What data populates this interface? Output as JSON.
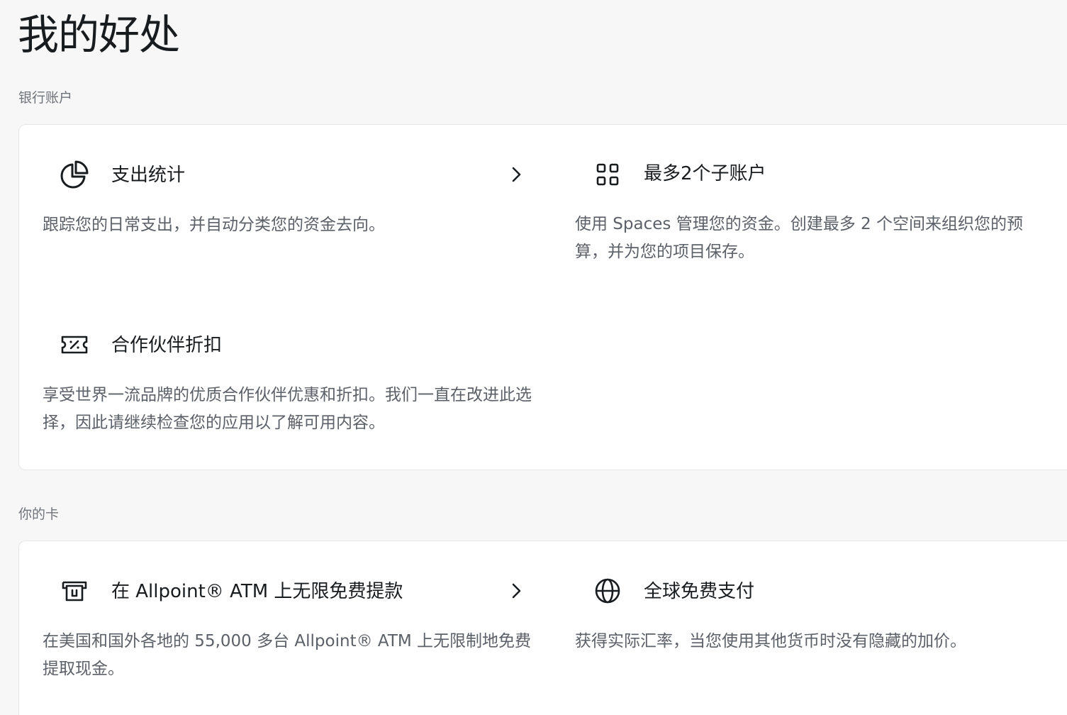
{
  "page": {
    "title": "我的好处"
  },
  "sections": {
    "bank": {
      "label": "银行账户",
      "items": [
        {
          "title": "支出统计",
          "icon": "pie-chart-icon",
          "description": "跟踪您的日常支出，并自动分类您的资金去向。",
          "has_chevron": true
        },
        {
          "title": "最多2个子账户",
          "icon": "grid-icon",
          "description": "使用 Spaces 管理您的资金。创建最多 2 个空间来组织您的预算，并为您的项目保存。",
          "has_chevron": false
        },
        {
          "title": "合作伙伴折扣",
          "icon": "discount-ticket-icon",
          "description": "享受世界一流品牌的优质合作伙伴优惠和折扣。我们一直在改进此选择，因此请继续检查您的应用以了解可用内容。",
          "has_chevron": false
        }
      ]
    },
    "cards": {
      "label": "你的卡",
      "items": [
        {
          "title": "在 Allpoint® ATM 上无限免费提款",
          "icon": "atm-icon",
          "description": "在美国和国外各地的 55,000 多台 Allpoint® ATM 上无限制地免费提取现金。",
          "has_chevron": true
        },
        {
          "title": "全球免费支付",
          "icon": "globe-icon",
          "description": "获得实际汇率，当您使用其他货币时没有隐藏的加价。",
          "has_chevron": false
        }
      ]
    }
  },
  "colors": {
    "background": "#f7f7f7",
    "card": "#ffffff",
    "text_primary": "#191c1f",
    "text_secondary": "#5c6068"
  }
}
